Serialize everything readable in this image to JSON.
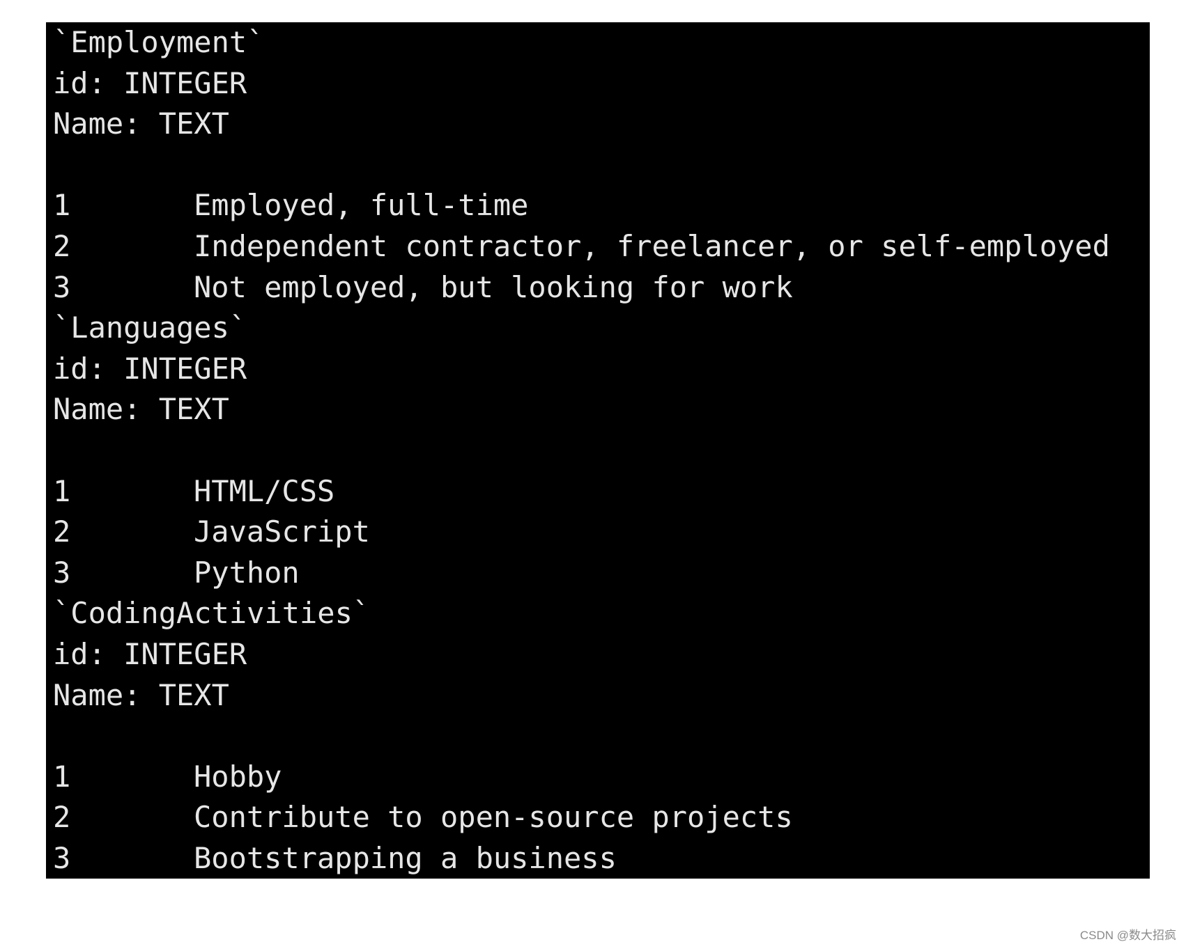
{
  "sections": [
    {
      "table": "`Employment`",
      "fields": [
        "id: INTEGER",
        "Name: TEXT"
      ],
      "rows": [
        {
          "id": "1",
          "name": "Employed, full-time"
        },
        {
          "id": "2",
          "name": "Independent contractor, freelancer, or self-employed"
        },
        {
          "id": "3",
          "name": "Not employed, but looking for work"
        }
      ]
    },
    {
      "table": "`Languages`",
      "fields": [
        "id: INTEGER",
        "Name: TEXT"
      ],
      "rows": [
        {
          "id": "1",
          "name": "HTML/CSS"
        },
        {
          "id": "2",
          "name": "JavaScript"
        },
        {
          "id": "3",
          "name": "Python"
        }
      ]
    },
    {
      "table": "`CodingActivities`",
      "fields": [
        "id: INTEGER",
        "Name: TEXT"
      ],
      "rows": [
        {
          "id": "1",
          "name": "Hobby"
        },
        {
          "id": "2",
          "name": "Contribute to open-source projects"
        },
        {
          "id": "3",
          "name": "Bootstrapping a business"
        }
      ]
    }
  ],
  "watermark": "CSDN @数大招疯"
}
